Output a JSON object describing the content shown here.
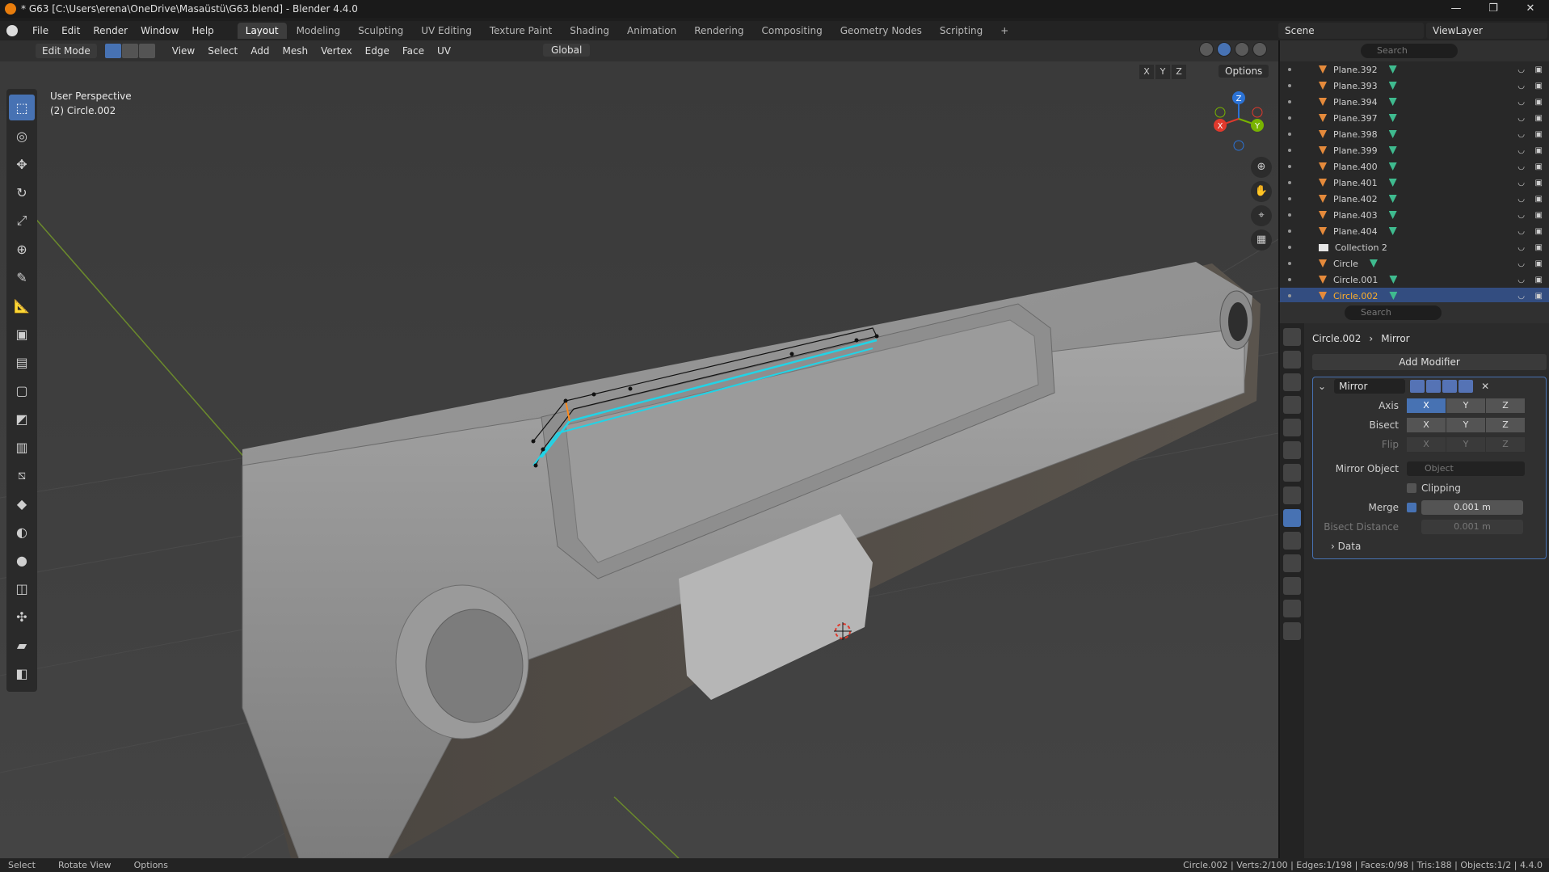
{
  "window": {
    "title": "* G63 [C:\\Users\\erena\\OneDrive\\Masaüstü\\G63.blend] - Blender 4.4.0",
    "controls": [
      "—",
      "❐",
      "✕"
    ]
  },
  "menubar": {
    "items": [
      "File",
      "Edit",
      "Render",
      "Window",
      "Help"
    ],
    "workspaces": [
      "Layout",
      "Modeling",
      "Sculpting",
      "UV Editing",
      "Texture Paint",
      "Shading",
      "Animation",
      "Rendering",
      "Compositing",
      "Geometry Nodes",
      "Scripting"
    ],
    "active_workspace": "Layout",
    "scene": "Scene",
    "view_layer": "ViewLayer"
  },
  "viewport_header": {
    "mode": "Edit Mode",
    "menus": [
      "View",
      "Select",
      "Add",
      "Mesh",
      "Vertex",
      "Edge",
      "Face",
      "UV"
    ],
    "transform_orientation": "Global",
    "options": "Options",
    "axes": [
      "X",
      "Y",
      "Z"
    ]
  },
  "viewport": {
    "view_name": "User Perspective",
    "object_label": "(2) Circle.002"
  },
  "gizmo": {
    "x": "X",
    "y": "Y",
    "z": "Z"
  },
  "outliner": {
    "search_placeholder": "Search",
    "rows": [
      {
        "name": "Plane.392",
        "kind": "mesh"
      },
      {
        "name": "Plane.393",
        "kind": "mesh"
      },
      {
        "name": "Plane.394",
        "kind": "mesh"
      },
      {
        "name": "Plane.397",
        "kind": "mesh"
      },
      {
        "name": "Plane.398",
        "kind": "mesh"
      },
      {
        "name": "Plane.399",
        "kind": "mesh"
      },
      {
        "name": "Plane.400",
        "kind": "mesh"
      },
      {
        "name": "Plane.401",
        "kind": "mesh"
      },
      {
        "name": "Plane.402",
        "kind": "mesh"
      },
      {
        "name": "Plane.403",
        "kind": "mesh"
      },
      {
        "name": "Plane.404",
        "kind": "mesh"
      },
      {
        "name": "Collection 2",
        "kind": "collection"
      },
      {
        "name": "Circle",
        "kind": "mesh"
      },
      {
        "name": "Circle.001",
        "kind": "mesh"
      },
      {
        "name": "Circle.002",
        "kind": "mesh",
        "selected": true
      }
    ]
  },
  "properties": {
    "search_placeholder": "Search",
    "breadcrumb_object": "Circle.002",
    "breadcrumb_modifier": "Mirror",
    "add_modifier": "Add Modifier",
    "modifier_name": "Mirror",
    "axis_label": "Axis",
    "bisect_label": "Bisect",
    "flip_label": "Flip",
    "axes": [
      "X",
      "Y",
      "Z"
    ],
    "mirror_object_label": "Mirror Object",
    "mirror_object_placeholder": "Object",
    "clipping_label": "Clipping",
    "merge_label": "Merge",
    "merge_value": "0.001 m",
    "bisect_distance_label": "Bisect Distance",
    "bisect_distance_value": "0.001 m",
    "data_label": "Data"
  },
  "statusbar": {
    "select": "Select",
    "rotate": "Rotate View",
    "options": "Options",
    "stats": "Circle.002 | Verts:2/100 | Edges:1/198 | Faces:0/98 | Tris:188 | Objects:1/2 | 4.4.0"
  }
}
